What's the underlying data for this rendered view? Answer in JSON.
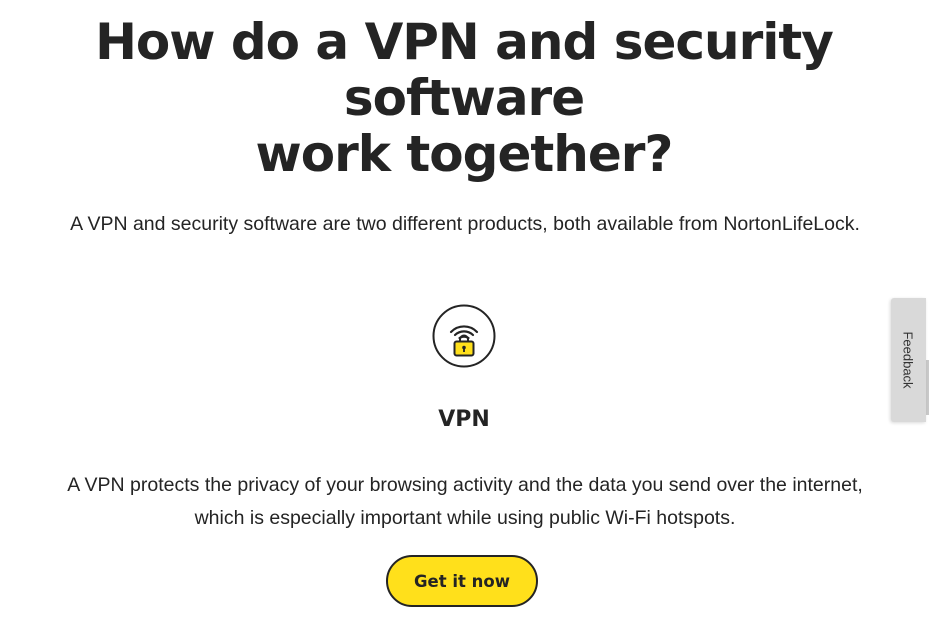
{
  "heading": {
    "lines": [
      "How do a VPN and security",
      "software",
      "work together?"
    ]
  },
  "intro": "A VPN and security software are two different products, both available from NortonLifeLock.",
  "vpn_section": {
    "icon": "wifi-lock-icon",
    "title": "VPN",
    "description_lines": [
      "A VPN protects the privacy of your browsing activity and the data you send over the internet,",
      "which is especially important while using public Wi-Fi hotspots."
    ],
    "cta_label": "Get it now"
  },
  "feedback": {
    "label": "Feedback"
  },
  "colors": {
    "text": "#242424",
    "accent_yellow": "#ffe01b",
    "feedback_bg": "#d9d9d9"
  }
}
